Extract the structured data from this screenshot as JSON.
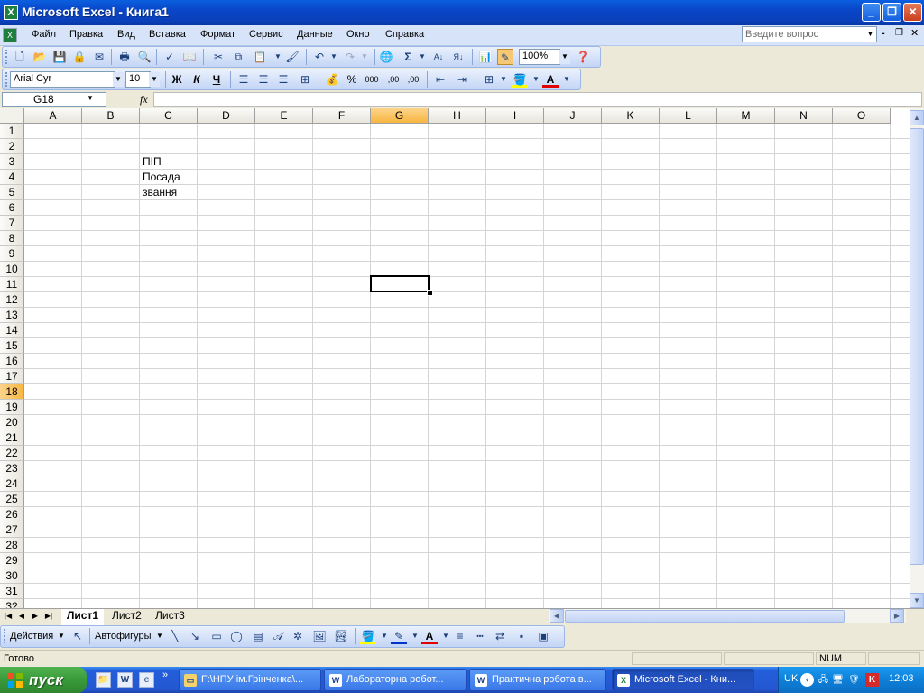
{
  "window": {
    "title": "Microsoft Excel - Книга1"
  },
  "menu": {
    "items": [
      "Файл",
      "Правка",
      "Вид",
      "Вставка",
      "Формат",
      "Сервис",
      "Данные",
      "Окно",
      "Справка"
    ],
    "help_placeholder": "Введите вопрос"
  },
  "standard_toolbar": {
    "zoom": "100%"
  },
  "format_toolbar": {
    "font": "Arial Cyr",
    "size": "10",
    "bold": "Ж",
    "italic": "К",
    "underline": "Ч",
    "percent": "%",
    "thousands": "000",
    "dec_inc": ",00",
    "dec_dec": ",00"
  },
  "formula_bar": {
    "name_box": "G18",
    "fx": "fx",
    "formula": ""
  },
  "grid": {
    "columns": [
      "A",
      "B",
      "C",
      "D",
      "E",
      "F",
      "G",
      "H",
      "I",
      "J",
      "K",
      "L",
      "M",
      "N",
      "O"
    ],
    "rows": [
      "1",
      "2",
      "3",
      "4",
      "5",
      "6",
      "7",
      "8",
      "9",
      "10",
      "11",
      "12",
      "13",
      "14",
      "15",
      "16",
      "17",
      "18",
      "19",
      "20",
      "21",
      "22",
      "23",
      "24",
      "25",
      "26",
      "27",
      "28",
      "29",
      "30",
      "31",
      "32"
    ],
    "selected_column": "G",
    "selected_row": "18",
    "cells": {
      "C3": "ПІП",
      "C4": "Посада",
      "C5": "звання"
    }
  },
  "sheet_tabs": [
    "Лист1",
    "Лист2",
    "Лист3"
  ],
  "drawing_toolbar": {
    "actions": "Действия",
    "autoshapes": "Автофигуры"
  },
  "status": {
    "text": "Готово",
    "num": "NUM"
  },
  "taskbar": {
    "start": "пуск",
    "buttons": [
      {
        "label": "F:\\НПУ ім.Грінченка\\...",
        "icon": "folder"
      },
      {
        "label": "Лабораторна робот...",
        "icon": "word"
      },
      {
        "label": "Практична робота в...",
        "icon": "word"
      },
      {
        "label": "Microsoft Excel - Кни...",
        "icon": "excel"
      }
    ],
    "lang": "UK",
    "clock": "12:03"
  }
}
